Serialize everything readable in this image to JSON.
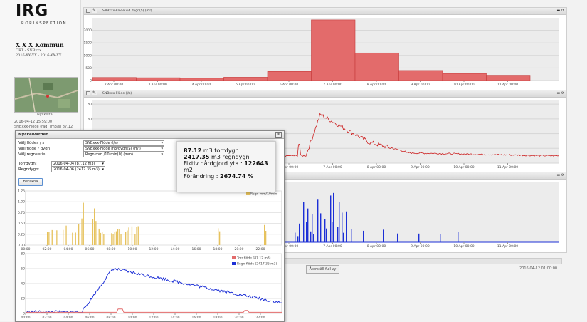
{
  "logo": {
    "big": "IRG",
    "small": "RÖRINSPEKTION"
  },
  "info": {
    "title": "X X X Kommun",
    "line1": "ORT - SNBxxx",
    "line2": "2016-XX-XX - 2016-XX-XX"
  },
  "map_caption": "Nyckeltal",
  "meta": {
    "line1": "2016-04-12 15:59:00",
    "line2": "SNBxxx-Flöde (rad) [m3/s] 87.12"
  },
  "panels": [
    {
      "title": "SNBxxx-Flöde vid dygn(S) (m³)"
    },
    {
      "title": "SNBxxx-Flöde (l/s)"
    },
    {
      "title": "SNBxxx-Regn (mm)"
    }
  ],
  "x_ticks": [
    "2 Apr 00:00",
    "3 Apr 00:00",
    "4 Apr 00:00",
    "5 Apr 00:00",
    "6 Apr 00:00",
    "7 Apr 00:00",
    "8 Apr 00:00",
    "9 Apr 00:00",
    "10 Apr 00:00",
    "11 Apr 00:00"
  ],
  "dialog": {
    "title": "Nyckelvärden",
    "close": "×",
    "rows": [
      {
        "label": "Välj flödes / s",
        "value": "SNBxxx-Flöde (l/s)"
      },
      {
        "label": "Välj flöde / dygn",
        "value": "SNBxxx-Flöde m3/dygn(S) (m³)"
      },
      {
        "label": "Välj regnserie",
        "value": "Regn mm /10 min(0) (mm)"
      }
    ],
    "torrdygn_label": "Torrdygn:",
    "torrdygn_value": "2016-04-04 (87.12 m3)",
    "regndygn_label": "Regndygn:",
    "regndygn_value": "2016-04-06 (2417.35 m3)",
    "button": "Beräkna",
    "rain_legend": "Regn mm/10min",
    "flow_legend1": "Torr flöde (87.12 m3)",
    "flow_legend2": "Regn flöde (2417.35 m3)",
    "hours": [
      "00:00",
      "02:00",
      "04:00",
      "06:00",
      "08:00",
      "10:00",
      "12:00",
      "14:00",
      "16:00",
      "18:00",
      "20:00",
      "22:00"
    ]
  },
  "popup": {
    "torr_val": "87.12",
    "torr_txt": " m3 torrdygn",
    "regn_val": "2417.35",
    "regn_txt": " m3 regndygn",
    "yta_txt": "Fiktiv hårdgjord yta : ",
    "yta_val": "122643",
    "yta_unit": " m2",
    "fr_txt": "Förändring : ",
    "fr_val": "2674.74 %"
  },
  "reset": "Återställ full vy",
  "stamp": "2016-04-12 01:00:00",
  "chart_data": [
    {
      "type": "bar",
      "title": "SNBxxx-Flöde vid dygn(S) (m³)",
      "categories": [
        "2 Apr",
        "3 Apr",
        "4 Apr",
        "5 Apr",
        "6 Apr",
        "7 Apr",
        "8 Apr",
        "9 Apr",
        "10 Apr",
        "11 Apr"
      ],
      "values": [
        120,
        110,
        90,
        130,
        360,
        2417,
        1100,
        400,
        280,
        210
      ],
      "ylim": [
        0,
        2500
      ],
      "color": "#e36b6b"
    },
    {
      "type": "line",
      "title": "SNBxxx-Flöde (l/s)",
      "color": "#cc1f1f"
    },
    {
      "type": "bar",
      "title": "SNBxxx-Regn (mm)",
      "color": "#1c2fd6"
    },
    {
      "type": "bar",
      "title": "Regn mm/10min",
      "color": "#e6c25d",
      "ylim": [
        0,
        1.25
      ]
    },
    {
      "type": "line",
      "series": [
        {
          "name": "Torr flöde (87.12 m3)",
          "color": "#e36b6b"
        },
        {
          "name": "Regn flöde (2417.35 m3)",
          "color": "#1c2fd6"
        }
      ],
      "ylim": [
        0,
        80
      ]
    }
  ]
}
